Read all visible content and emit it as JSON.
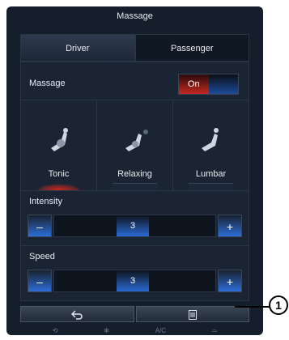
{
  "screen": {
    "title": "Massage",
    "tabs": [
      {
        "label": "Driver",
        "active": true
      },
      {
        "label": "Passenger",
        "active": false
      }
    ],
    "massage_row": {
      "label": "Massage",
      "toggle_on": "On"
    },
    "modes": [
      {
        "label": "Tonic",
        "icon": "seat-massage-tonic-icon",
        "selected": true
      },
      {
        "label": "Relaxing",
        "icon": "seat-massage-relaxing-icon",
        "selected": false
      },
      {
        "label": "Lumbar",
        "icon": "seat-massage-lumbar-icon",
        "selected": false
      }
    ],
    "intensity": {
      "label": "Intensity",
      "value": "3",
      "minus": "–",
      "plus": "+"
    },
    "speed": {
      "label": "Speed",
      "value": "3",
      "minus": "–",
      "plus": "+"
    },
    "bottom_buttons": {
      "back_icon": "back-arrow-icon",
      "menu_icon": "list-menu-icon"
    },
    "footer_items": [
      "climate-icon",
      "fan-icon",
      "A/C",
      "defrost-icon"
    ],
    "colors": {
      "accent_blue": "#2d6ed9",
      "accent_red": "#c2291f"
    }
  },
  "callout": {
    "number": "1"
  }
}
